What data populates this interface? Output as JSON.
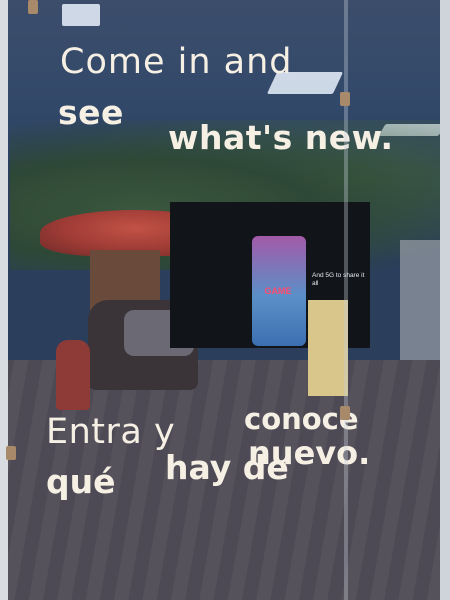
{
  "sign": {
    "english_line1": "Come in and",
    "english_line2a": "see",
    "english_line2b": "what's new.",
    "spanish_line1a": "Entra y",
    "spanish_line1b": "conoce",
    "spanish_line2a": "qué",
    "spanish_line2b": "hay de",
    "spanish_line2c": "nuevo."
  },
  "display": {
    "phone_text": "GAME",
    "screen_caption": "And 5G to share it all"
  },
  "colors": {
    "sign_text": "#f6f0e4",
    "background": "#2b3e5c",
    "mushroom": "#b24a3f"
  }
}
